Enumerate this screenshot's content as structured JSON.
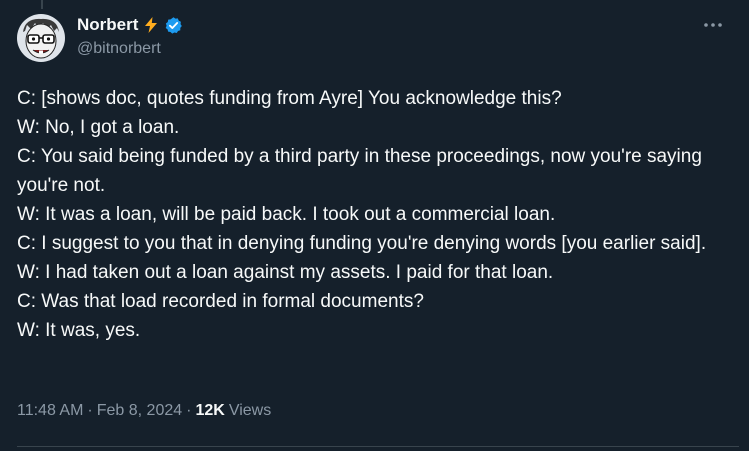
{
  "author": {
    "display_name": "Norbert",
    "handle": "@bitnorbert",
    "verified": true,
    "badge_icon": "lightning-bolt-icon",
    "avatar_icon": "cartoon-face-with-glasses-avatar"
  },
  "more_button_label": "···",
  "tweet": {
    "lines": [
      "C: [shows doc, quotes funding from Ayre] You acknowledge this?",
      "W: No, I got a loan.",
      "C: You said being funded by a third party in these proceedings, now you're saying you're not.",
      "W: It was a loan, will be paid back. I took out a commercial loan.",
      "C: I suggest to you that in denying funding you're denying words [you earlier said].",
      "W: I had taken out a loan against my assets. I paid for that loan.",
      "C: Was that load recorded in formal documents?",
      "W: It was, yes."
    ]
  },
  "meta": {
    "time": "11:48 AM",
    "separator": "·",
    "date": "Feb 8, 2024",
    "views_count": "12K",
    "views_label": "Views"
  },
  "colors": {
    "background": "#15202b",
    "text": "#f7f9f9",
    "secondary_text": "#8b98a5",
    "verified_blue": "#1d9bf0",
    "bolt_orange": "#ffad1f",
    "divider": "#38444d"
  }
}
